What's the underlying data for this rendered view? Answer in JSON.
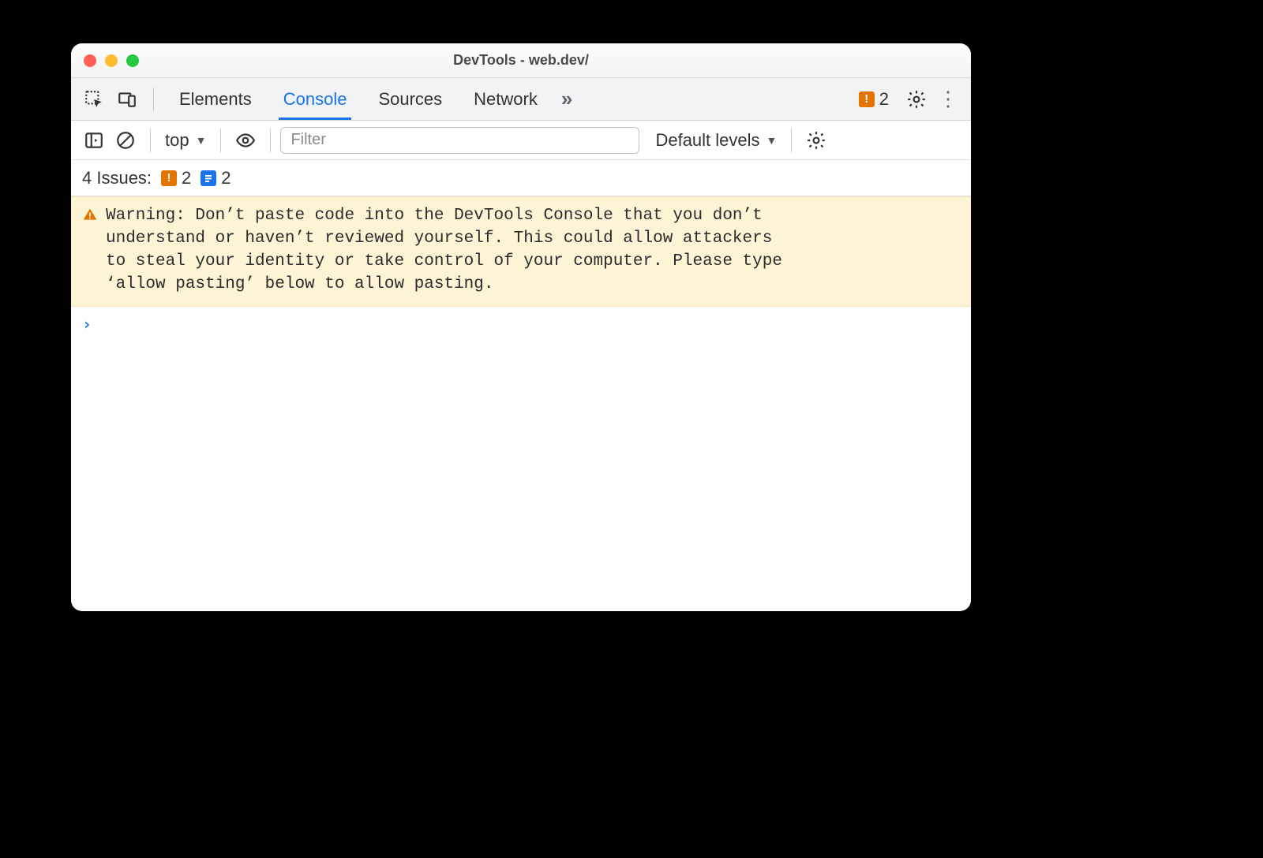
{
  "window": {
    "title": "DevTools - web.dev/"
  },
  "tabs": {
    "elements": "Elements",
    "console": "Console",
    "sources": "Sources",
    "network": "Network"
  },
  "topbar": {
    "issue_count": "2"
  },
  "toolbar": {
    "context": "top",
    "filter_placeholder": "Filter",
    "levels_label": "Default levels"
  },
  "issues": {
    "label": "4 Issues:",
    "orange_count": "2",
    "blue_count": "2"
  },
  "warning_text": "Warning: Don’t paste code into the DevTools Console that you don’t\nunderstand or haven’t reviewed yourself. This could allow attackers\nto steal your identity or take control of your computer. Please type\n‘allow pasting’ below to allow pasting."
}
